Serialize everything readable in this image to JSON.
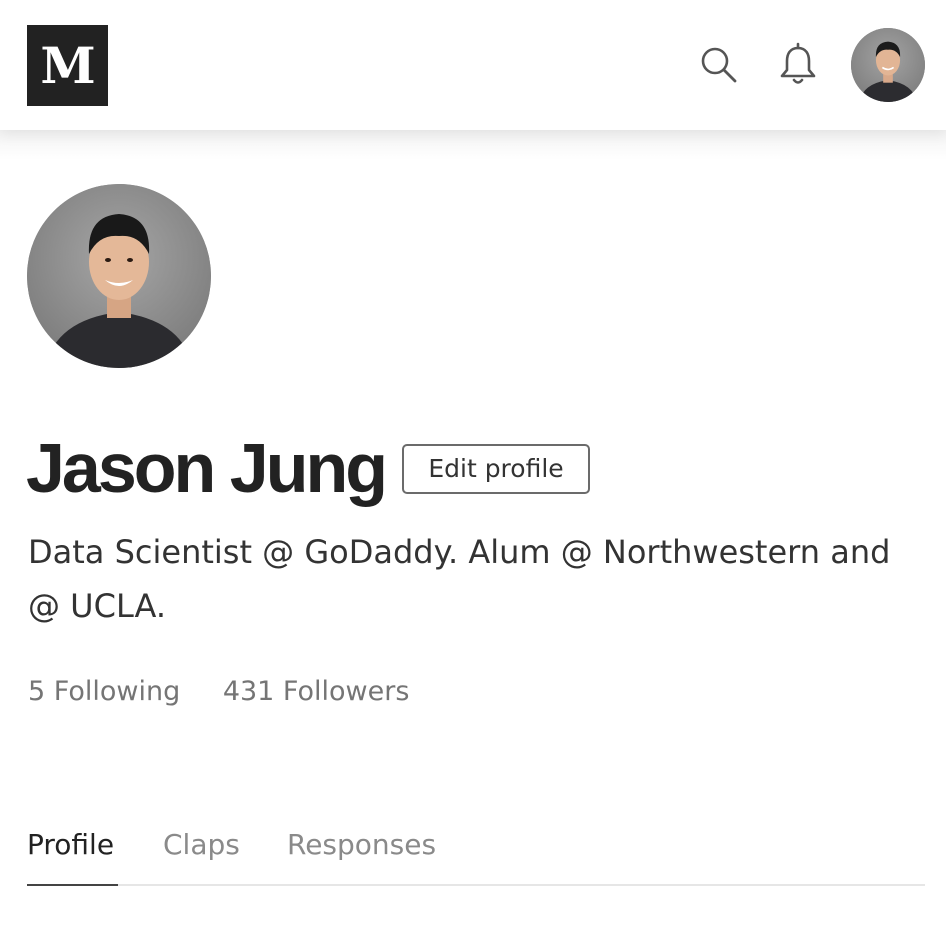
{
  "header": {
    "logo_letter": "M",
    "icons": [
      "search-icon",
      "bell-icon"
    ]
  },
  "profile": {
    "name": "Jason Jung",
    "edit_label": "Edit profile",
    "bio": "Data Scientist @ GoDaddy. Alum @ Northwestern and @ UCLA.",
    "following": "5 Following",
    "followers": "431 Followers"
  },
  "tabs": [
    {
      "label": "Profile",
      "active": true
    },
    {
      "label": "Claps",
      "active": false
    },
    {
      "label": "Responses",
      "active": false
    }
  ],
  "colors": {
    "logo_bg": "#222222",
    "text_primary": "#222222",
    "text_muted": "#757575",
    "tab_inactive": "#8a8a8a"
  }
}
